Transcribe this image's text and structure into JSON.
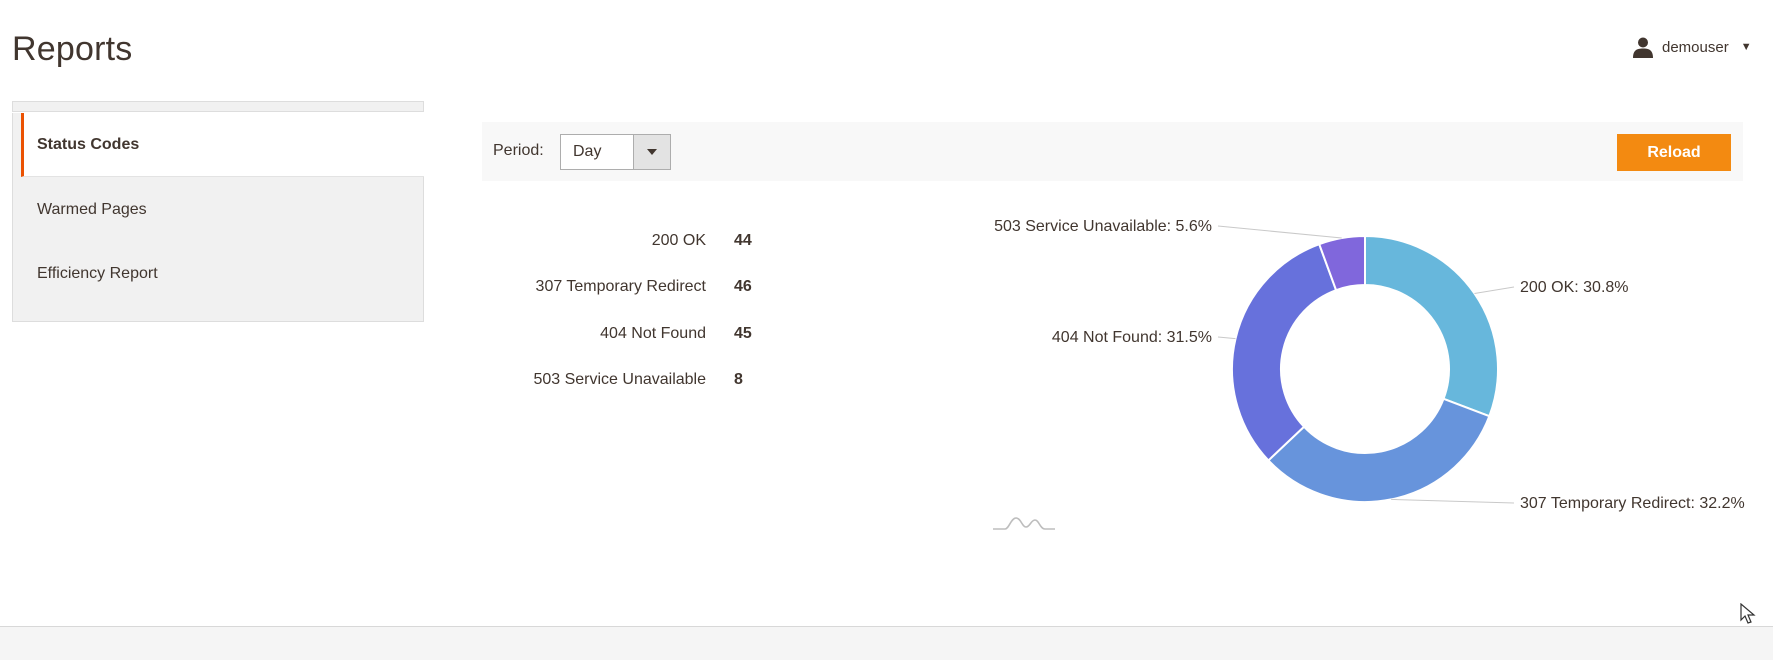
{
  "page": {
    "title": "Reports"
  },
  "user": {
    "name": "demouser",
    "icon": "user-icon",
    "menu_icon": "caret-down-icon"
  },
  "sidebar": {
    "items": [
      {
        "label": "Status Codes",
        "active": true
      },
      {
        "label": "Warmed Pages",
        "active": false
      },
      {
        "label": "Efficiency Report",
        "active": false
      }
    ]
  },
  "toolbar": {
    "period_label": "Period:",
    "period_value": "Day",
    "reload_label": "Reload",
    "reload_color": "#f38a11"
  },
  "stats": {
    "rows": [
      {
        "label": "200 OK",
        "value": "44"
      },
      {
        "label": "307 Temporary Redirect",
        "value": "46"
      },
      {
        "label": "404 Not Found",
        "value": "45"
      },
      {
        "label": "503 Service Unavailable",
        "value": "8"
      }
    ]
  },
  "chart_data": {
    "type": "pie",
    "donut": true,
    "slices": [
      {
        "label": "200 OK: 30.8%",
        "value": 30.8,
        "color": "#67b7dc"
      },
      {
        "label": "307 Temporary Redirect: 32.2%",
        "value": 32.2,
        "color": "#6794dc"
      },
      {
        "label": "404 Not Found: 31.5%",
        "value": 31.5,
        "color": "#6771dc"
      },
      {
        "label": "503 Service Unavailable: 5.6%",
        "value": 5.6,
        "color": "#8067dc"
      }
    ]
  },
  "accent_color": "#eb5202"
}
